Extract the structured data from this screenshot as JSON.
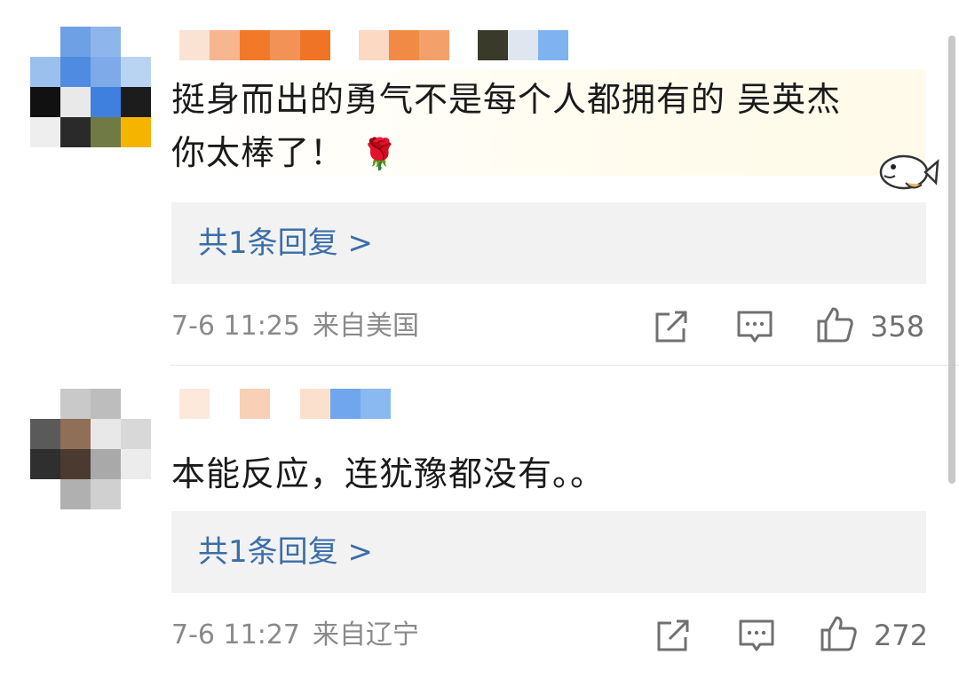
{
  "comments": [
    {
      "text_line1": "挺身而出的勇气不是每个人都拥有的 吴英杰",
      "text_line2": "你太棒了！",
      "emoji": "🌹",
      "reply_link": "共1条回复 >",
      "date": "7-6 11:25",
      "location": "来自美国",
      "likes": "358"
    },
    {
      "text_line1": "本能反应，连犹豫都没有。。",
      "reply_link": "共1条回复 >",
      "date": "7-6 11:27",
      "location": "来自辽宁",
      "likes": "272"
    }
  ],
  "icons": {
    "repost": "share-square-icon",
    "comment": "comment-bubble-icon",
    "like": "thumbs-up-icon",
    "sticker": "fish-sticker-icon"
  },
  "colors": {
    "reply_link": "#3a6ea8",
    "meta_text": "#8a8a8a",
    "reply_background": "#f2f2f2"
  }
}
